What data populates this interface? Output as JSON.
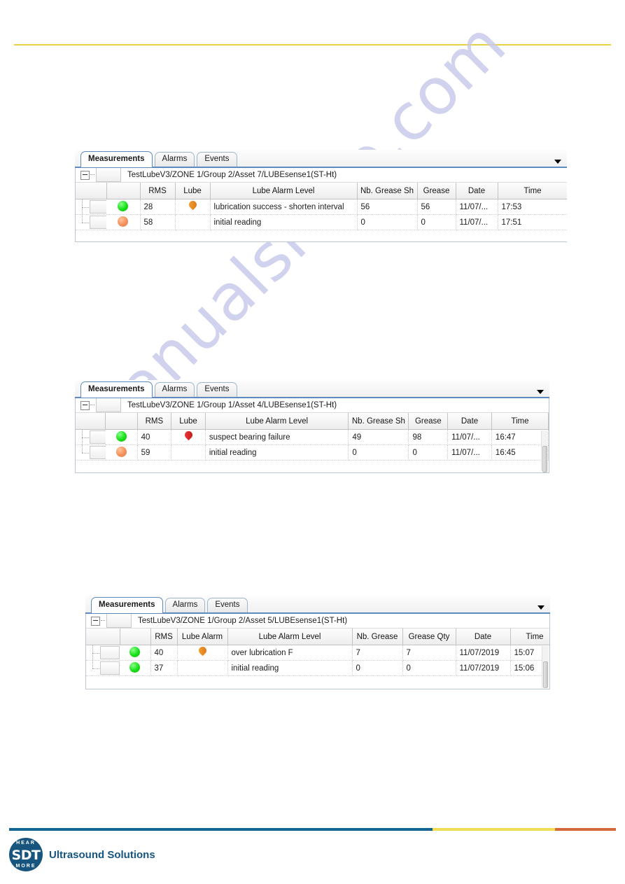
{
  "page": {
    "watermark": "manualshive.com",
    "top_rule_color": "#e8d040",
    "footer_rule_colors": {
      "blue": "#11658f",
      "yellow": "#f2dc52",
      "orange": "#d4693c"
    }
  },
  "footer": {
    "logo_top": "HEAR",
    "logo_main": "SDT",
    "logo_bottom": "MORE",
    "tagline": "Ultrasound Solutions"
  },
  "tabs": {
    "measurements": "Measurements",
    "alarms": "Alarms",
    "events": "Events"
  },
  "panels": [
    {
      "id": "panel-asset-7",
      "tree_path": "TestLubeV3/ZONE 1/Group 2/Asset 7/LUBEsense1(ST-Ht)",
      "columns": [
        "",
        "",
        "RMS",
        "Lube",
        "Lube Alarm Level",
        "Nb. Grease Sh",
        "Grease",
        "Date",
        "Time"
      ],
      "rows": [
        {
          "status": "green",
          "rms": "28",
          "lube_icon": "orange",
          "alarm_level": "lubrication success - shorten interval",
          "nb_grease": "56",
          "grease": "56",
          "date": "11/07/...",
          "time": "17:53"
        },
        {
          "status": "orange",
          "rms": "58",
          "lube_icon": "none",
          "alarm_level": "initial reading",
          "nb_grease": "0",
          "grease": "0",
          "date": "11/07/...",
          "time": "17:51"
        }
      ]
    },
    {
      "id": "panel-asset-4",
      "tree_path": "TestLubeV3/ZONE 1/Group 1/Asset 4/LUBEsense1(ST-Ht)",
      "columns": [
        "",
        "",
        "RMS",
        "Lube",
        "Lube Alarm Level",
        "Nb. Grease Sh",
        "Grease",
        "Date",
        "Time"
      ],
      "rows": [
        {
          "status": "green",
          "rms": "40",
          "lube_icon": "red",
          "alarm_level": "suspect bearing failure",
          "nb_grease": "49",
          "grease": "98",
          "date": "11/07/...",
          "time": "16:47"
        },
        {
          "status": "orange",
          "rms": "59",
          "lube_icon": "none",
          "alarm_level": "initial reading",
          "nb_grease": "0",
          "grease": "0",
          "date": "11/07/...",
          "time": "16:45"
        }
      ]
    },
    {
      "id": "panel-asset-5",
      "tree_path": "TestLubeV3/ZONE 1/Group 2/Asset 5/LUBEsense1(ST-Ht)",
      "columns": [
        "",
        "",
        "RMS",
        "Lube Alarm",
        "Lube Alarm Level",
        "Nb. Grease",
        "Grease Qty",
        "Date",
        "Time"
      ],
      "rows": [
        {
          "status": "green",
          "rms": "40",
          "lube_icon": "orange",
          "alarm_level": "over lubrication F",
          "nb_grease": "7",
          "grease": "7",
          "date": "11/07/2019",
          "time": "15:07"
        },
        {
          "status": "green",
          "rms": "37",
          "lube_icon": "none",
          "alarm_level": "initial reading",
          "nb_grease": "0",
          "grease": "0",
          "date": "11/07/2019",
          "time": "15:06"
        }
      ]
    }
  ]
}
